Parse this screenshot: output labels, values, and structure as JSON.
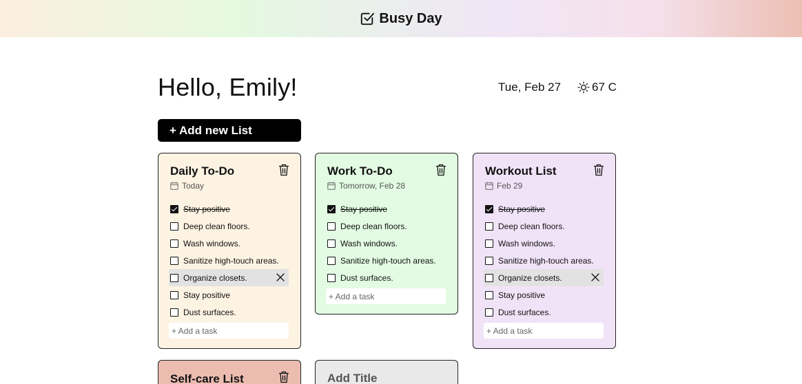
{
  "header": {
    "app_name": "Busy Day",
    "icon": "checkbox-icon"
  },
  "greeting": "Hello, Emily!",
  "date": "Tue, Feb 27",
  "weather": {
    "icon": "sun-icon",
    "temp": "67 C"
  },
  "add_list_label": "+ Add new List",
  "colors": {
    "daily": "#fdf3e3",
    "work": "#e3fbe3",
    "workout": "#f1e3f7",
    "selfcare": "#ecbcb1",
    "new": "#e9e9e9"
  },
  "lists": [
    {
      "title": "Daily To-Do",
      "date": "Today",
      "tasks": [
        {
          "label": "Stay positive",
          "done": true
        },
        {
          "label": "Deep clean floors.",
          "done": false
        },
        {
          "label": "Wash windows.",
          "done": false
        },
        {
          "label": "Sanitize high-touch areas.",
          "done": false
        },
        {
          "label": "Organize closets.",
          "done": false
        },
        {
          "label": "Stay positive",
          "done": false
        },
        {
          "label": "Dust surfaces.",
          "done": false
        }
      ],
      "add_placeholder": "+ Add a task"
    },
    {
      "title": "Work To-Do",
      "date": "Tomorrow, Feb 28",
      "tasks": [
        {
          "label": "Stay positive",
          "done": true
        },
        {
          "label": "Deep clean floors.",
          "done": false
        },
        {
          "label": "Wash windows.",
          "done": false
        },
        {
          "label": "Sanitize high-touch areas.",
          "done": false
        },
        {
          "label": "Dust surfaces.",
          "done": false
        }
      ],
      "add_placeholder": "+ Add a task"
    },
    {
      "title": "Workout List",
      "date": "Feb 29",
      "tasks": [
        {
          "label": "Stay positive",
          "done": true
        },
        {
          "label": "Deep clean floors.",
          "done": false
        },
        {
          "label": "Wash windows.",
          "done": false
        },
        {
          "label": "Sanitize high-touch areas.",
          "done": false
        },
        {
          "label": "Organize closets.",
          "done": false
        },
        {
          "label": "Stay positive",
          "done": false
        },
        {
          "label": "Dust surfaces.",
          "done": false
        }
      ],
      "add_placeholder": "+ Add a task"
    },
    {
      "title": "Self-care List"
    },
    {
      "title": "Add Title"
    }
  ]
}
